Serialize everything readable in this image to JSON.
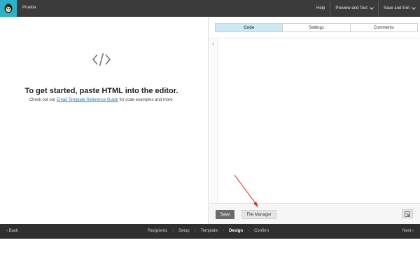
{
  "header": {
    "campaign_name": "Prueba",
    "actions": [
      {
        "label": "Help",
        "has_dropdown": false
      },
      {
        "label": "Preview and Test",
        "has_dropdown": true
      },
      {
        "label": "Save and Exit",
        "has_dropdown": true
      }
    ],
    "logo_color": "#2ab3c8"
  },
  "left_pane": {
    "icon": "code-brackets-icon",
    "headline": "To get started, paste HTML into the editor.",
    "sub_before": "Check out our ",
    "sub_link": "Email Template Reference Guide",
    "sub_after": " for code examples and more."
  },
  "editor": {
    "tabs": [
      {
        "label": "Code",
        "active": true
      },
      {
        "label": "Settings",
        "active": false
      },
      {
        "label": "Comments",
        "active": false
      }
    ],
    "line_number": "1",
    "save_label": "Save",
    "file_manager_label": "File Manager",
    "expand_icon": "expand-icon"
  },
  "footer": {
    "back_label": "Back",
    "next_label": "Next",
    "steps": [
      "Recipients",
      "Setup",
      "Template",
      "Design",
      "Confirm"
    ],
    "current_step": "Design"
  },
  "annotation": {
    "arrow_color": "#d9261c"
  }
}
